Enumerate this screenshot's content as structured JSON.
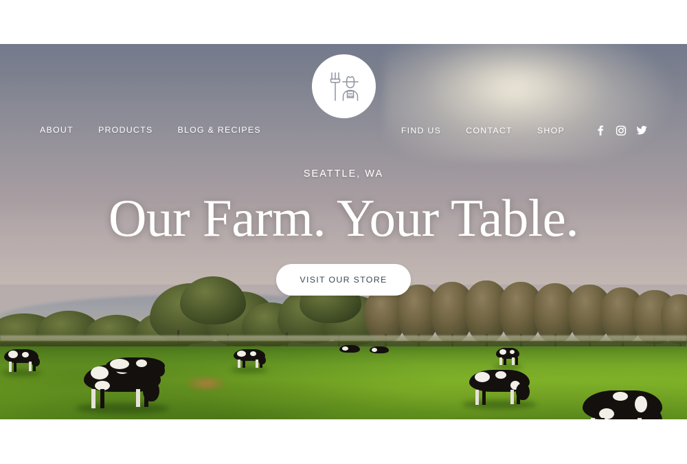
{
  "site": {
    "logo_icon": "farmer-with-pitchfork-icon",
    "logo_alt": "Farmer with pitchfork logo"
  },
  "nav": {
    "left_items": [
      {
        "label": "ABOUT",
        "name": "nav-link-about"
      },
      {
        "label": "PRODUCTS",
        "name": "nav-link-products"
      },
      {
        "label": "BLOG & RECIPES",
        "name": "nav-link-blog-recipes"
      }
    ],
    "right_items": [
      {
        "label": "FIND US",
        "name": "nav-link-find-us"
      },
      {
        "label": "CONTACT",
        "name": "nav-link-contact"
      },
      {
        "label": "SHOP",
        "name": "nav-link-shop"
      }
    ],
    "social": [
      {
        "icon": "facebook-icon",
        "label": "Facebook"
      },
      {
        "icon": "instagram-icon",
        "label": "Instagram"
      },
      {
        "icon": "twitter-icon",
        "label": "Twitter"
      }
    ]
  },
  "hero": {
    "eyebrow": "SEATTLE, WA",
    "headline": "Our Farm. Your Table.",
    "cta_label": "VISIT OUR STORE",
    "background_alt": "Black and white dairy cows grazing in a green pasture at sunset with a line of trees on the horizon"
  },
  "colors": {
    "text_on_hero": "#ffffff",
    "cta_background": "#ffffff",
    "cta_text": "#3d4653",
    "logo_background": "#ffffff",
    "logo_line": "#8d93a1",
    "page_background": "#ffffff",
    "sky_top": "#737a8c",
    "sky_bottom": "#b7adad",
    "grass": "#79ad27"
  }
}
